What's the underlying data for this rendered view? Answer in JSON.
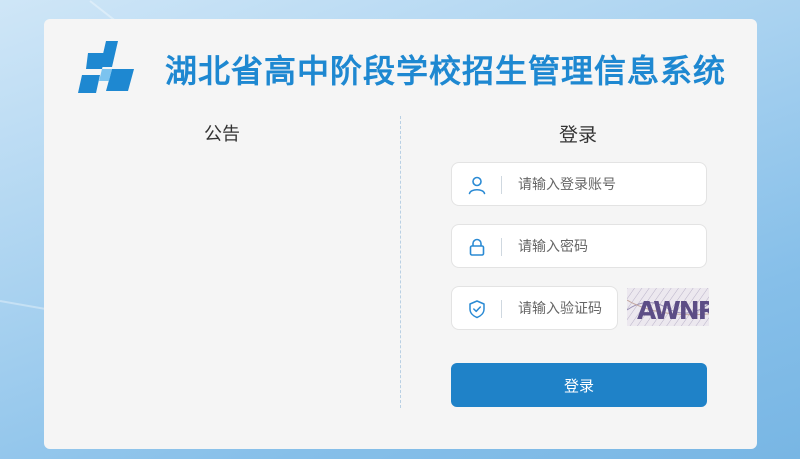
{
  "site": {
    "title": "湖北省高中阶段学校招生管理信息系统"
  },
  "notice": {
    "title": "公告"
  },
  "login": {
    "title": "登录",
    "username_placeholder": "请输入登录账号",
    "password_placeholder": "请输入密码",
    "captcha_placeholder": "请输入验证码",
    "captcha_text": "AWNR",
    "submit_label": "登录"
  },
  "icons": {
    "logo": "logo-icon",
    "username": "user-icon",
    "password": "lock-icon",
    "captcha": "shield-check-icon"
  },
  "colors": {
    "brand": "#1e88d1",
    "button": "#1f82c8",
    "icon": "#2a8ad4",
    "card": "#f5f5f5"
  }
}
